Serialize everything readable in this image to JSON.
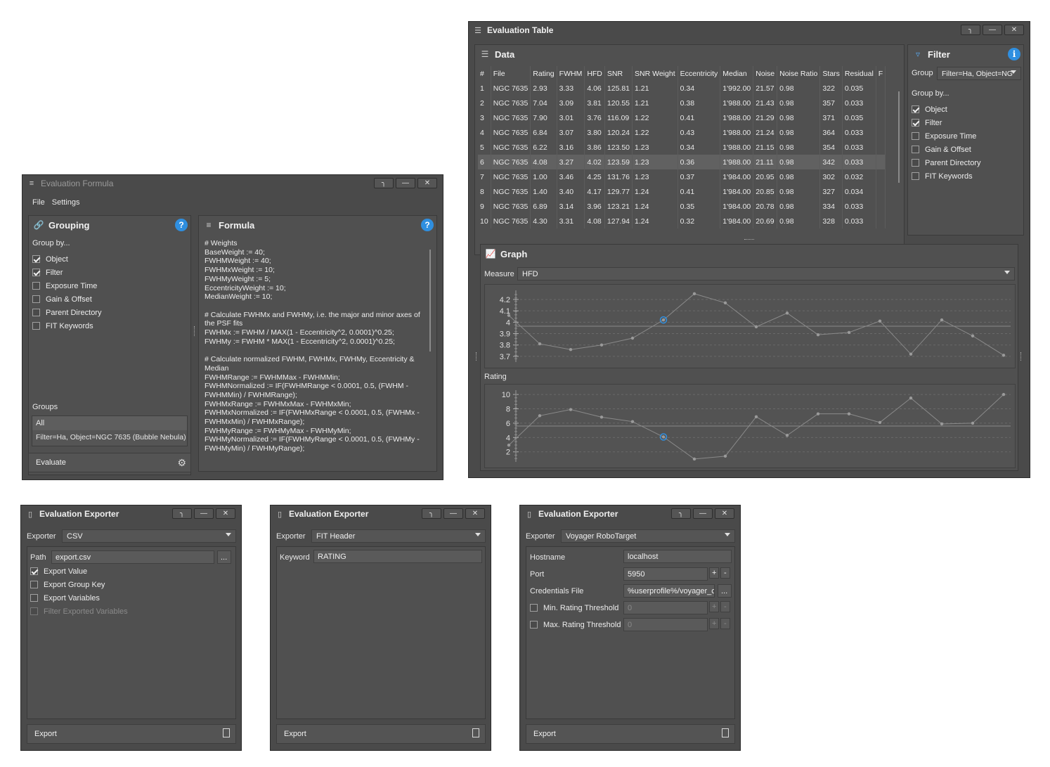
{
  "formula_window": {
    "title": "Evaluation Formula",
    "menu": [
      "File",
      "Settings"
    ],
    "grouping": {
      "title": "Grouping",
      "group_by_label": "Group by...",
      "options": [
        {
          "label": "Object",
          "checked": true
        },
        {
          "label": "Filter",
          "checked": true
        },
        {
          "label": "Exposure Time",
          "checked": false
        },
        {
          "label": "Gain & Offset",
          "checked": false
        },
        {
          "label": "Parent Directory",
          "checked": false
        },
        {
          "label": "FIT Keywords",
          "checked": false
        }
      ],
      "groups_label": "Groups",
      "groups": [
        "All",
        "Filter=Ha, Object=NGC 7635 (Bubble Nebula)"
      ],
      "evaluate_label": "Evaluate"
    },
    "formula": {
      "title": "Formula",
      "lines": [
        "# Weights",
        "BaseWeight := 40;",
        "FWHMWeight := 40;",
        "FWHMxWeight := 10;",
        "FWHMyWeight := 5;",
        "EccentricityWeight := 10;",
        "MedianWeight := 10;",
        "",
        "# Calculate FWHMx and FWHMy, i.e. the major and minor axes of",
        "the PSF fits",
        "FWHMx := FWHM / MAX(1 - Eccentricity^2, 0.0001)^0.25;",
        "FWHMy := FWHM * MAX(1 - Eccentricity^2, 0.0001)^0.25;",
        "",
        "# Calculate normalized FWHM, FWHMx, FWHMy, Eccentricity &",
        "Median",
        "FWHMRange := FWHMMax - FWHMMin;",
        "FWHMNormalized := IF(FWHMRange < 0.0001, 0.5,  (FWHM -",
        "FWHMMin) / FWHMRange);",
        "FWHMxRange := FWHMxMax - FWHMxMin;",
        "FWHMxNormalized := IF(FWHMxRange < 0.0001, 0.5,  (FWHMx -",
        "FWHMxMin) / FWHMxRange);",
        "FWHMyRange := FWHMyMax - FWHMyMin;",
        "FWHMyNormalized := IF(FWHMyRange < 0.0001, 0.5,  (FWHMy -",
        "FWHMyMin) / FWHMyRange);"
      ]
    }
  },
  "table_window": {
    "title": "Evaluation Table",
    "data_title": "Data",
    "columns": [
      "#",
      "File",
      "Rating",
      "FWHM",
      "HFD",
      "SNR",
      "SNR Weight",
      "Eccentricity",
      "Median",
      "Noise",
      "Noise Ratio",
      "Stars",
      "Residual",
      "F"
    ],
    "rows": [
      [
        "1",
        "NGC 7635",
        "2.93",
        "3.33",
        "4.06",
        "125.81",
        "1.21",
        "0.34",
        "1'992.00",
        "21.57",
        "0.98",
        "322",
        "0.035"
      ],
      [
        "2",
        "NGC 7635",
        "7.04",
        "3.09",
        "3.81",
        "120.55",
        "1.21",
        "0.38",
        "1'988.00",
        "21.43",
        "0.98",
        "357",
        "0.033"
      ],
      [
        "3",
        "NGC 7635",
        "7.90",
        "3.01",
        "3.76",
        "116.09",
        "1.22",
        "0.41",
        "1'988.00",
        "21.29",
        "0.98",
        "371",
        "0.035"
      ],
      [
        "4",
        "NGC 7635",
        "6.84",
        "3.07",
        "3.80",
        "120.24",
        "1.22",
        "0.43",
        "1'988.00",
        "21.24",
        "0.98",
        "364",
        "0.033"
      ],
      [
        "5",
        "NGC 7635",
        "6.22",
        "3.16",
        "3.86",
        "123.50",
        "1.23",
        "0.34",
        "1'988.00",
        "21.15",
        "0.98",
        "354",
        "0.033"
      ],
      [
        "6",
        "NGC 7635",
        "4.08",
        "3.27",
        "4.02",
        "123.59",
        "1.23",
        "0.36",
        "1'988.00",
        "21.11",
        "0.98",
        "342",
        "0.033"
      ],
      [
        "7",
        "NGC 7635",
        "1.00",
        "3.46",
        "4.25",
        "131.76",
        "1.23",
        "0.37",
        "1'984.00",
        "20.95",
        "0.98",
        "302",
        "0.032"
      ],
      [
        "8",
        "NGC 7635",
        "1.40",
        "3.40",
        "4.17",
        "129.77",
        "1.24",
        "0.41",
        "1'984.00",
        "20.85",
        "0.98",
        "327",
        "0.034"
      ],
      [
        "9",
        "NGC 7635",
        "6.89",
        "3.14",
        "3.96",
        "123.21",
        "1.24",
        "0.35",
        "1'984.00",
        "20.78",
        "0.98",
        "334",
        "0.033"
      ],
      [
        "10",
        "NGC 7635",
        "4.30",
        "3.31",
        "4.08",
        "127.94",
        "1.24",
        "0.32",
        "1'984.00",
        "20.69",
        "0.98",
        "328",
        "0.033"
      ]
    ],
    "selected_row": 6,
    "filter": {
      "title": "Filter",
      "group_label": "Group",
      "group_value": "Filter=Ha, Object=NG",
      "group_by_label": "Group by...",
      "options": [
        {
          "label": "Object",
          "checked": true
        },
        {
          "label": "Filter",
          "checked": true
        },
        {
          "label": "Exposure Time",
          "checked": false
        },
        {
          "label": "Gain & Offset",
          "checked": false
        },
        {
          "label": "Parent Directory",
          "checked": false
        },
        {
          "label": "FIT Keywords",
          "checked": false
        }
      ]
    },
    "graph": {
      "title": "Graph",
      "measure_label": "Measure",
      "measure_value": "HFD",
      "rating_label": "Rating"
    }
  },
  "chart_data": [
    {
      "type": "line",
      "title": "",
      "ylabel": "HFD",
      "yticks": [
        "3.7",
        "3.8",
        "3.9",
        "4",
        "4.1",
        "4.2"
      ],
      "ylim": [
        3.65,
        4.28
      ],
      "values": [
        4.06,
        3.81,
        3.76,
        3.8,
        3.86,
        4.02,
        4.25,
        4.17,
        3.96,
        4.08,
        3.89,
        3.91,
        4.01,
        3.72,
        4.02,
        3.88,
        3.71
      ],
      "highlight_index": 5,
      "color": "#8a8a8a",
      "highlight_color": "#2f8fe0"
    },
    {
      "type": "line",
      "title": "",
      "ylabel": "Rating",
      "yticks": [
        "2",
        "4",
        "6",
        "8",
        "10"
      ],
      "ylim": [
        0.6,
        10.6
      ],
      "values": [
        2.93,
        7.04,
        7.9,
        6.84,
        6.22,
        4.08,
        1.0,
        1.4,
        6.89,
        4.3,
        7.3,
        7.3,
        6.1,
        9.5,
        5.9,
        6.0,
        10.0
      ],
      "highlight_index": 5,
      "color": "#8a8a8a",
      "highlight_color": "#2f8fe0"
    }
  ],
  "exporters": [
    {
      "title": "Evaluation Exporter",
      "exporter_label": "Exporter",
      "exporter_value": "CSV",
      "path_label": "Path",
      "path_value": "export.csv",
      "browse": "...",
      "options": [
        {
          "label": "Export Value",
          "checked": true,
          "disabled": false
        },
        {
          "label": "Export Group Key",
          "checked": false,
          "disabled": false
        },
        {
          "label": "Export Variables",
          "checked": false,
          "disabled": false
        },
        {
          "label": "Filter Exported Variables",
          "checked": false,
          "disabled": true
        }
      ],
      "export_label": "Export"
    },
    {
      "title": "Evaluation Exporter",
      "exporter_label": "Exporter",
      "exporter_value": "FIT Header",
      "keyword_label": "Keyword",
      "keyword_value": "RATING",
      "export_label": "Export"
    },
    {
      "title": "Evaluation Exporter",
      "exporter_label": "Exporter",
      "exporter_value": "Voyager RoboTarget",
      "hostname_label": "Hostname",
      "hostname_value": "localhost",
      "port_label": "Port",
      "port_value": "5950",
      "credentials_label": "Credentials File",
      "credentials_value": "%userprofile%/voyager_c",
      "browse": "...",
      "min_label": "Min. Rating Threshold",
      "min_value": "0",
      "max_label": "Max. Rating Threshold",
      "max_value": "0",
      "plus": "+",
      "minus": "-",
      "export_label": "Export"
    }
  ]
}
